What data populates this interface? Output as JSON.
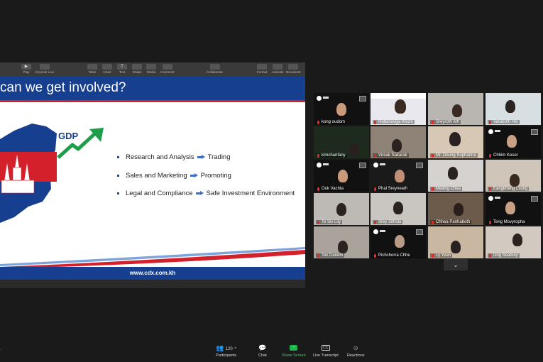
{
  "keynote_toolbar": {
    "items": [
      {
        "label": "Play",
        "icon": "play-icon"
      },
      {
        "label": "Keynote Live",
        "icon": "keynote-live-icon"
      },
      {
        "label": "Table",
        "icon": "table-icon"
      },
      {
        "label": "Chart",
        "icon": "chart-icon"
      },
      {
        "label": "Text",
        "icon": "text-icon"
      },
      {
        "label": "Shape",
        "icon": "shape-icon"
      },
      {
        "label": "Media",
        "icon": "media-icon"
      },
      {
        "label": "Comment",
        "icon": "comment-icon"
      },
      {
        "label": "Collaborate",
        "icon": "collaborate-icon"
      },
      {
        "label": "Format",
        "icon": "format-icon"
      },
      {
        "label": "Animate",
        "icon": "animate-icon"
      },
      {
        "label": "Document",
        "icon": "document-icon"
      }
    ]
  },
  "slide": {
    "title": "can we get involved?",
    "gdp_label": "GDP",
    "bullets": [
      {
        "left": "Research and Analysis",
        "right": "Trading"
      },
      {
        "left": "Sales and Marketing",
        "right": "Promoting"
      },
      {
        "left": "Legal and Compliance",
        "right": "Safe Investment Environment"
      }
    ],
    "url": "www.cdx.com.kh",
    "colors": {
      "brand_blue": "#173f8f",
      "brand_red": "#d4202a",
      "growth_green": "#1e9e48"
    }
  },
  "gallery": {
    "participants": [
      {
        "name": "kong oudom"
      },
      {
        "name": "Rattanavijja Khom"
      },
      {
        "name": "Sreyroth Ath"
      },
      {
        "name": "Varaboth Hel"
      },
      {
        "name": "kimchanfany"
      },
      {
        "name": "Vireak Sakarak"
      },
      {
        "name": "Mr. Doung Sophanna"
      },
      {
        "name": "Chhim Kesor"
      },
      {
        "name": "Ouk Vachta"
      },
      {
        "name": "Phal Sreyneath"
      },
      {
        "name": "Meiling Chea"
      },
      {
        "name": "Eangkheng Lsung"
      },
      {
        "name": "Te Siv Lily"
      },
      {
        "name": "Srey Sithida"
      },
      {
        "name": "Chhea Panhaboth"
      },
      {
        "name": "Teng Movyropha"
      },
      {
        "name": "Tek Daneth"
      },
      {
        "name": "Pichchorra Chhe"
      },
      {
        "name": "Ly Yean"
      },
      {
        "name": "Ung Seamey"
      }
    ],
    "more_arrow": "⌄"
  },
  "bottom_bar": {
    "participants_count": "120",
    "participants_label": "Participants",
    "chat_label": "Chat",
    "share_screen_label": "Share Screen",
    "live_transcript_label": "Live Transcript",
    "cc_text": "CC",
    "reactions_label": "Reactions",
    "share_color": "#1fb34b"
  }
}
